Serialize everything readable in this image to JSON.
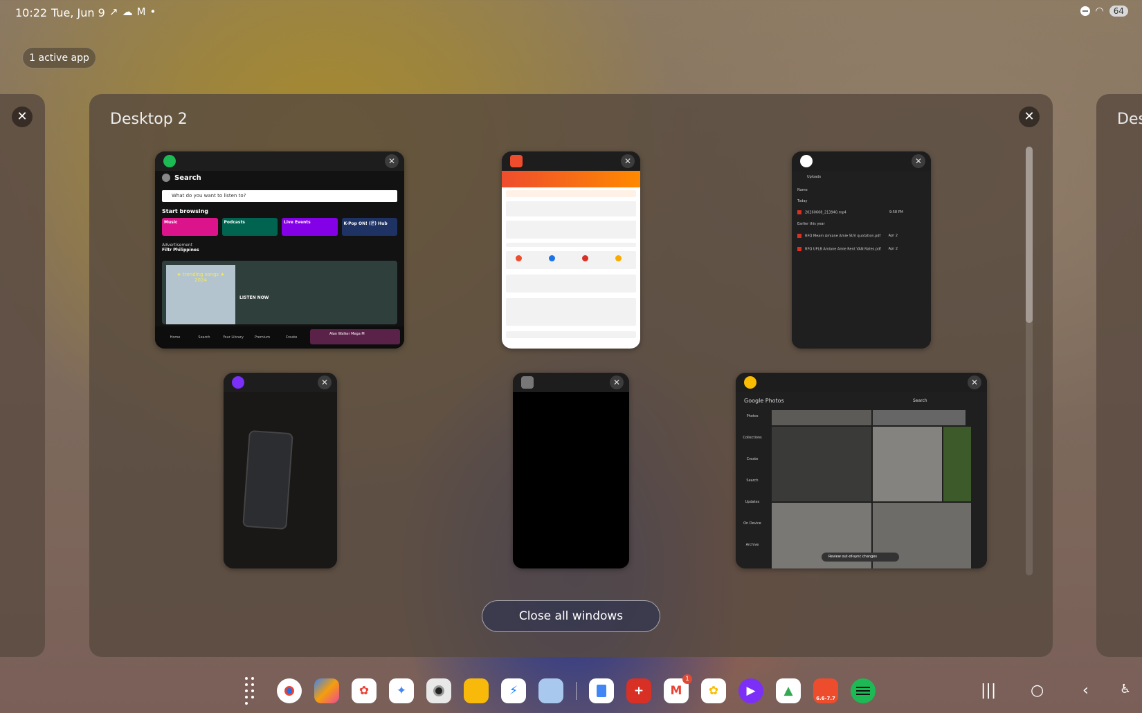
{
  "status_bar": {
    "time": "10:22",
    "date": "Tue, Jun 9",
    "battery": "64"
  },
  "active_apps_label": "1 active app",
  "desktop": {
    "title": "Desktop 2",
    "next_title": "Des",
    "windows": [
      {
        "app": "Spotify",
        "color": "#1db954"
      },
      {
        "app": "Shopee",
        "color": "#ee4d2d"
      },
      {
        "app": "Google Drive",
        "color": "#4285f4"
      },
      {
        "app": "Video Player",
        "color": "#7b2ff7"
      },
      {
        "app": "Camera",
        "color": "#555555"
      },
      {
        "app": "Google Photos",
        "color": "#fbbc04"
      }
    ]
  },
  "spotify": {
    "header": "Search",
    "search_placeholder": "What do you want to listen to?",
    "start_browsing": "Start browsing",
    "tiles": [
      "Music",
      "Podcasts",
      "Live Events",
      "K-Pop ON! (온) Hub"
    ],
    "ad_label": "Advertisement",
    "ad_name": "Filtr Philippines",
    "cover_text": "★ trending songs ★ 2024",
    "listen_now": "LISTEN NOW",
    "nav": [
      "Home",
      "Search",
      "Your Library",
      "Premium",
      "Create"
    ],
    "now_playing": "Alan Walker Mega M"
  },
  "drive": {
    "folder": "Uploads",
    "name_header": "Name",
    "today": "Today",
    "file1": "20260608_213940.mp4",
    "file1_time": "9:58 PM",
    "earlier": "Earlier this year",
    "file2": "RFQ Meam Amiane Amie SUV quotation.pdf",
    "file2_date": "Apr 2",
    "file3": "RFQ UPLB Amiane Amie Rent VAN Rates.pdf",
    "file3_date": "Apr 2"
  },
  "photos": {
    "title": "Google Photos",
    "search": "Search",
    "side": [
      "Photos",
      "Collections",
      "Create",
      "Search",
      "Updates",
      "On Device",
      "Archive"
    ],
    "toast": "Review out-of-sync changes"
  },
  "close_all": "Close all windows",
  "dock": {
    "apps": [
      "Apps",
      "Chrome",
      "Copilot",
      "Pinwheel",
      "Gemini",
      "Camera",
      "Files",
      "Messenger",
      "Wallet",
      "Docs",
      "Plus",
      "Gmail",
      "Photos",
      "Player",
      "Drive",
      "Shopee",
      "Spotify"
    ],
    "gmail_badge": "1",
    "shopee_label": "6.6-7.7"
  }
}
